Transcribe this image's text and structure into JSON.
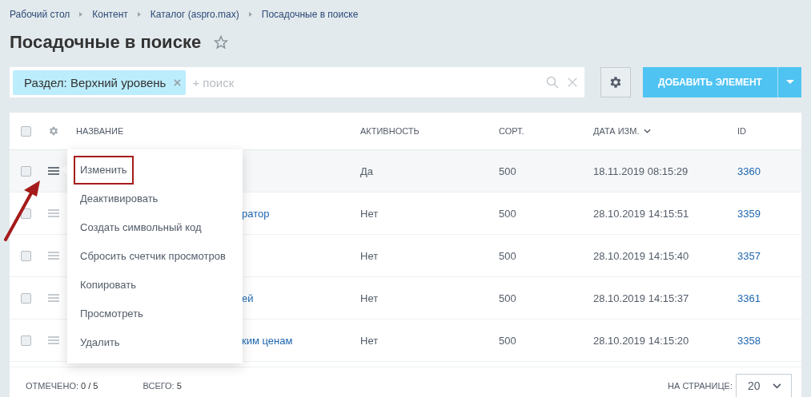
{
  "breadcrumbs": [
    "Рабочий стол",
    "Контент",
    "Каталог (aspro.max)",
    "Посадочные в поиске"
  ],
  "title": "Посадочные в поиске",
  "favorite": false,
  "filter": {
    "tag": "Раздел: Верхний уровень",
    "placeholder": "+ поиск"
  },
  "add_button": "ДОБАВИТЬ ЭЛЕМЕНТ",
  "table": {
    "select_all": false,
    "columns": [
      "НАЗВАНИЕ",
      "АКТИВНОСТЬ",
      "СОРТ.",
      "ДАТА ИЗМ.",
      "ID"
    ],
    "rows": [
      {
        "checked": false,
        "menu_open": true,
        "active": "Да",
        "sort": "500",
        "date": "18.11.2019 08:15:29",
        "id": "3360"
      },
      {
        "checked": false,
        "menu_open": false,
        "name": "ратор",
        "active": "Нет",
        "sort": "500",
        "date": "28.10.2019 14:15:51",
        "id": "3359"
      },
      {
        "checked": false,
        "menu_open": false,
        "active": "Нет",
        "sort": "500",
        "date": "28.10.2019 14:15:40",
        "id": "3357"
      },
      {
        "checked": false,
        "menu_open": false,
        "name": "ей",
        "active": "Нет",
        "sort": "500",
        "date": "28.10.2019 14:15:37",
        "id": "3361"
      },
      {
        "checked": false,
        "menu_open": false,
        "name": "ким ценам",
        "active": "Нет",
        "sort": "500",
        "date": "28.10.2019 14:15:20",
        "id": "3358"
      }
    ]
  },
  "context_menu": [
    {
      "label": "Изменить",
      "outlined": true
    },
    {
      "label": "Деактивировать",
      "outlined": false
    },
    {
      "label": "Создать символьный код",
      "outlined": false
    },
    {
      "label": "Сбросить счетчик просмотров",
      "outlined": false
    },
    {
      "label": "Копировать",
      "outlined": false
    },
    {
      "label": "Просмотреть",
      "outlined": false
    },
    {
      "label": "Удалить",
      "outlined": false
    }
  ],
  "footer": {
    "selected_label": "ОТМЕЧЕНО:",
    "selected_value": "0 / 5",
    "total_label": "ВСЕГО:",
    "total_value": "5",
    "per_page_label": "НА СТРАНИЦЕ:",
    "per_page": "20"
  }
}
